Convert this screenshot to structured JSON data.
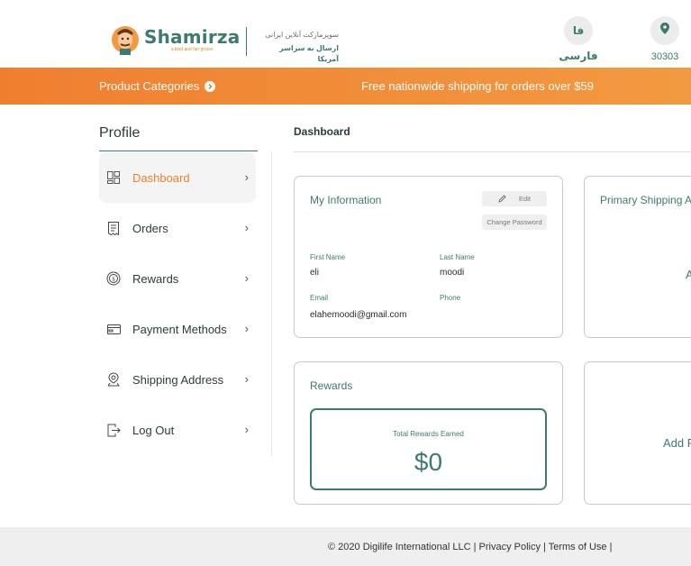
{
  "header": {
    "logo_name": "Shamirza",
    "logo_tagline": "a kind and fair grocer",
    "persian_line1": "سوپرمارکت آنلاین ایرانی",
    "persian_line2": "ارسال به سراسر آمریکا",
    "lang_badge": "فا",
    "lang_label": "فارسی",
    "location_icon": "map-pin-icon",
    "zip": "30303"
  },
  "topbar": {
    "categories_label": "Product Categories",
    "promo": "Free nationwide shipping for orders over $59"
  },
  "sidebar": {
    "title": "Profile",
    "items": [
      {
        "label": "Dashboard",
        "icon": "dashboard-icon",
        "active": true
      },
      {
        "label": "Orders",
        "icon": "receipt-icon"
      },
      {
        "label": "Rewards",
        "icon": "coin-icon"
      },
      {
        "label": "Payment Methods",
        "icon": "card-icon"
      },
      {
        "label": "Shipping Address",
        "icon": "location-icon"
      },
      {
        "label": "Log Out",
        "icon": "logout-icon"
      }
    ],
    "chevron": "›"
  },
  "main": {
    "title": "Dashboard",
    "my_info": {
      "title": "My Information",
      "edit_label": "Edit",
      "change_password_label": "Change Password",
      "first_name_label": "First Name",
      "first_name": "eli",
      "last_name_label": "Last Name",
      "last_name": "moodi",
      "email_label": "Email",
      "email": "elahemoodi@gmail.com",
      "phone_label": "Phone",
      "phone": ""
    },
    "shipping": {
      "title": "Primary Shipping A",
      "content": "A"
    },
    "rewards": {
      "title": "Rewards",
      "total_label": "Total Rewards Earned",
      "total_value": "$0"
    },
    "payment": {
      "content": "Add F"
    }
  },
  "footer": {
    "text": "© 2020 Digilife International LLC | Privacy Policy | Terms of Use |"
  },
  "colors": {
    "brand_green": "#3d7a6f",
    "brand_orange": "#ef7f30"
  }
}
